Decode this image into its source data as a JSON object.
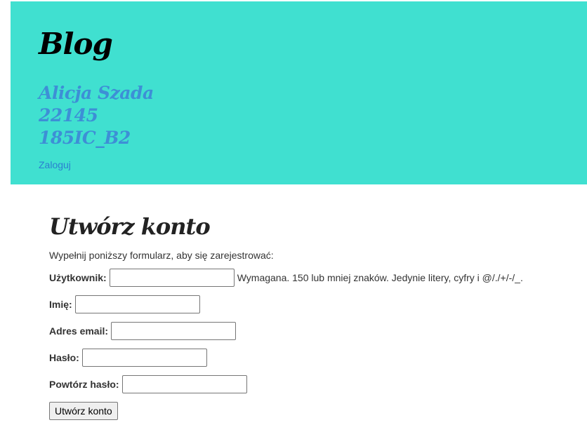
{
  "header": {
    "blog_title": "Blog",
    "author_lines": [
      "Alicja Szada",
      "22145",
      "185IC_B2"
    ],
    "login_link": "Zaloguj",
    "background_color": "#40e0d0"
  },
  "form": {
    "title": "Utwórz konto",
    "intro": "Wypełnij poniższy formularz, aby się zarejestrować:",
    "fields": [
      {
        "label": "Użytkownik:",
        "value": "",
        "help": "Wymagana. 150 lub mniej znaków. Jedynie litery, cyfry i @/./+/-/_."
      },
      {
        "label": "Imię:",
        "value": ""
      },
      {
        "label": "Adres email:",
        "value": ""
      },
      {
        "label": "Hasło:",
        "value": ""
      },
      {
        "label": "Powtórz hasło:",
        "value": ""
      }
    ],
    "submit_label": "Utwórz konto"
  }
}
